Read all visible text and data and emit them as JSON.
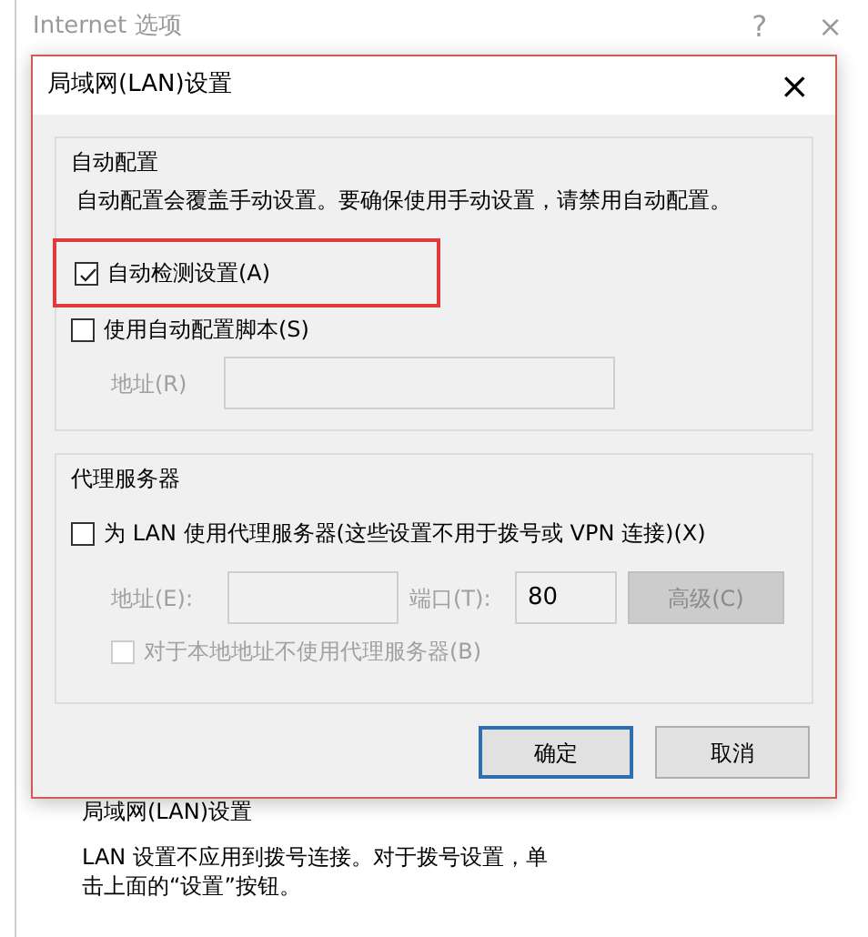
{
  "window": {
    "title": "Internet 选项",
    "help": "?",
    "close": "×"
  },
  "dialog": {
    "title": "局域网(LAN)设置",
    "close": "×",
    "auto_config": {
      "legend": "自动配置",
      "description": "自动配置会覆盖手动设置。要确保使用手动设置，请禁用自动配置。",
      "detect": {
        "label": "自动检测设置(A)",
        "checked": true,
        "highlighted": true
      },
      "script": {
        "label": "使用自动配置脚本(S)",
        "checked": false
      },
      "address": {
        "label": "地址(R)",
        "disabled": true
      }
    },
    "proxy": {
      "legend": "代理服务器",
      "use_proxy": {
        "label": "为 LAN 使用代理服务器(这些设置不用于拨号或 VPN 连接)(X)",
        "checked": false
      },
      "address": {
        "label": "地址(E):",
        "disabled": true
      },
      "port": {
        "label": "端口(T):",
        "value": "80",
        "disabled": true
      },
      "advanced": {
        "label": "高级(C)",
        "disabled": true
      },
      "bypass": {
        "label": "对于本地地址不使用代理服务器(B)",
        "checked": false,
        "disabled": true
      }
    },
    "buttons": [
      {
        "label": "确定",
        "default": true
      },
      {
        "label": "取消",
        "default": false
      }
    ]
  },
  "background": {
    "section_title": "局域网(LAN)设置",
    "description": "LAN 设置不应用到拨号连接。对于拨号设置，单击上面的“设置”按钮。"
  }
}
